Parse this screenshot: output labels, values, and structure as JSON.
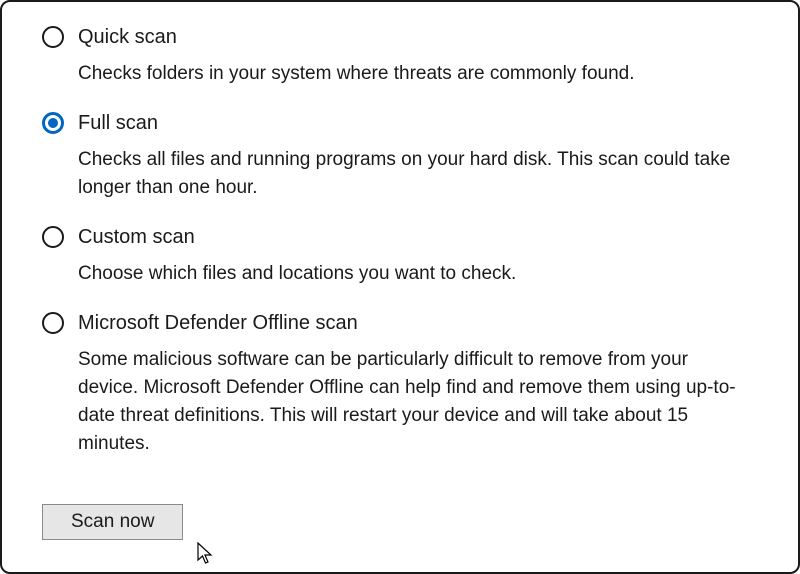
{
  "options": [
    {
      "id": "quick",
      "label": "Quick scan",
      "description": "Checks folders in your system where threats are commonly found.",
      "selected": false
    },
    {
      "id": "full",
      "label": "Full scan",
      "description": "Checks all files and running programs on your hard disk. This scan could take longer than one hour.",
      "selected": true
    },
    {
      "id": "custom",
      "label": "Custom scan",
      "description": "Choose which files and locations you want to check.",
      "selected": false
    },
    {
      "id": "offline",
      "label": "Microsoft Defender Offline scan",
      "description": "Some malicious software can be particularly difficult to remove from your device. Microsoft Defender Offline can help find and remove them using up-to-date threat definitions. This will restart your device and will take about 15 minutes.",
      "selected": false
    }
  ],
  "scan_button_label": "Scan now"
}
